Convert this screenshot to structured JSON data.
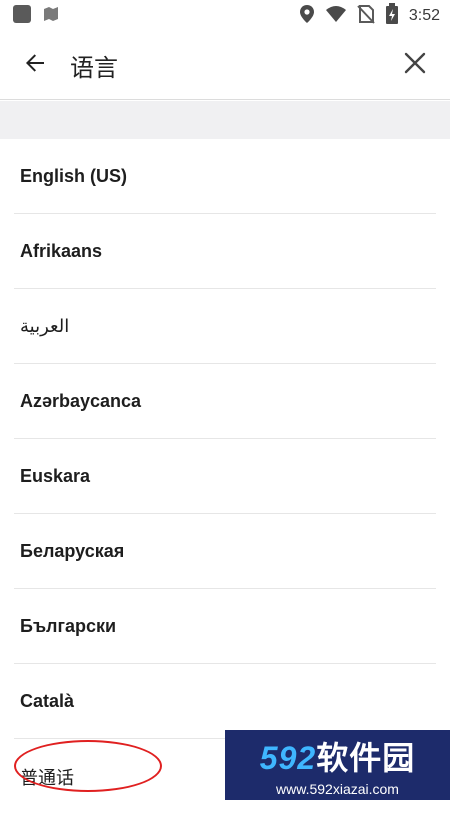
{
  "status_bar": {
    "time": "3:52",
    "icons": [
      "app-square-icon",
      "map-icon",
      "location-icon",
      "wifi-icon",
      "no-sim-icon",
      "battery-charging-icon"
    ]
  },
  "header": {
    "title": "语言",
    "back_icon": "arrow-left-icon",
    "close_icon": "close-icon"
  },
  "languages": [
    {
      "label": "English (US)"
    },
    {
      "label": "Afrikaans"
    },
    {
      "label": "العربية"
    },
    {
      "label": "Azərbaycanca"
    },
    {
      "label": "Euskara"
    },
    {
      "label": "Беларуская"
    },
    {
      "label": "Български"
    },
    {
      "label": "Català"
    },
    {
      "label": "普通话"
    }
  ],
  "watermark": {
    "brand_number": "592",
    "brand_text": "软件园",
    "url": "www.592xiazai.com"
  },
  "colors": {
    "annotation": "#e02020",
    "watermark_bg": "#1d2b6b",
    "watermark_accent": "#3fb6ff",
    "divider": "#e6e6e6",
    "spacer": "#f0f0f2"
  }
}
